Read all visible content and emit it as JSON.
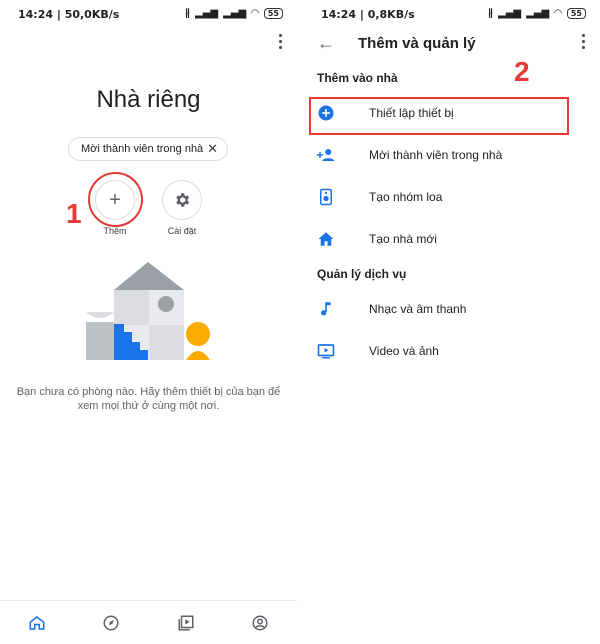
{
  "left": {
    "status": {
      "time": "14:24 | 50,0KB/s",
      "battery": "55"
    },
    "title": "Nhà riêng",
    "chip": {
      "label": "Mời thành viên trong nhà",
      "close": "✕"
    },
    "actions": [
      {
        "label": "Thêm",
        "icon": "plus-icon",
        "glyph": "+"
      },
      {
        "label": "Cài đặt",
        "icon": "gear-icon"
      }
    ],
    "step_number": "1",
    "empty_text": "Bạn chưa có phòng nào. Hãy thêm thiết bị của bạn để xem mọi thứ ở cùng một nơi.",
    "bottom_nav": [
      "home-icon",
      "compass-icon",
      "media-icon",
      "account-icon"
    ]
  },
  "right": {
    "status": {
      "time": "14:24 | 0,8KB/s",
      "battery": "55"
    },
    "back": "←",
    "title": "Thêm và quản lý",
    "step_number": "2",
    "section1": "Thêm vào nhà",
    "items1": [
      {
        "label": "Thiết lập thiết bị",
        "icon": "add-circle-icon"
      },
      {
        "label": "Mời thành viên trong nhà",
        "icon": "person-add-icon"
      },
      {
        "label": "Tạo nhóm loa",
        "icon": "speaker-icon"
      },
      {
        "label": "Tạo nhà mới",
        "icon": "home-icon"
      }
    ],
    "section2": "Quản lý dịch vụ",
    "items2": [
      {
        "label": "Nhạc và âm thanh",
        "icon": "music-note-icon"
      },
      {
        "label": "Video và ảnh",
        "icon": "video-icon"
      }
    ]
  },
  "colors": {
    "accent": "#1a73e8",
    "highlight": "#e53935",
    "illustration_yellow": "#f9ab00"
  }
}
